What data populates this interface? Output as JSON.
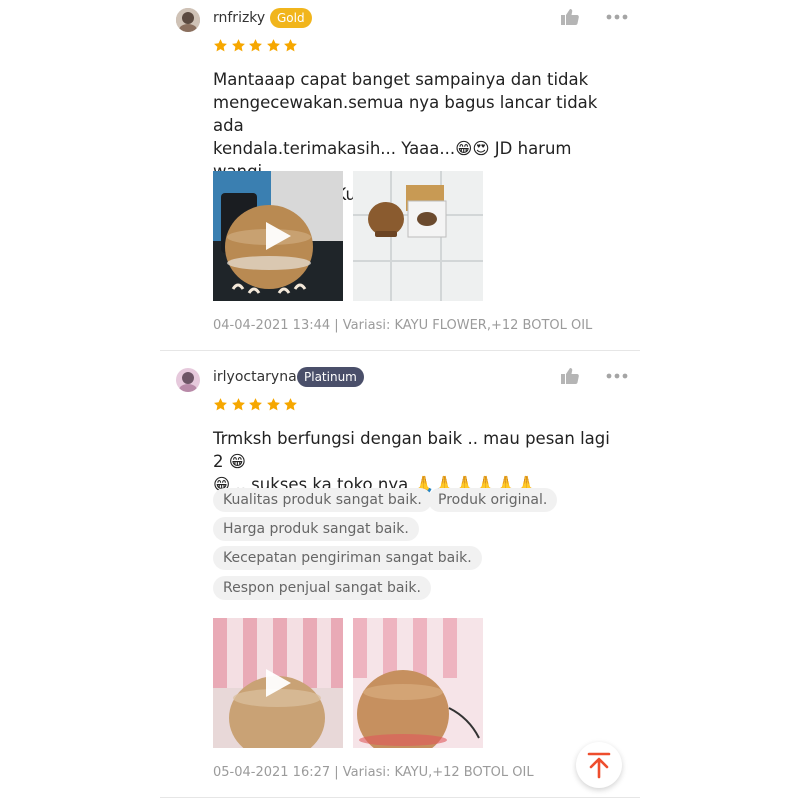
{
  "reviews": [
    {
      "username": "rnfrizky",
      "badge": "Gold",
      "rating": 5,
      "text_lines": [
        "Mantaaap capat banget sampainya dan tidak",
        "mengecewakan.semua nya bagus lancar tidak ada",
        "kendala.terimakasih... Yaaa...😁😍 JD harum wangi",
        "banget rumah Ku...😍😍😁"
      ],
      "meta": "04-04-2021 13:44 | Variasi: KAYU FLOWER,+12 BOTOL OIL",
      "media": [
        {
          "type": "video",
          "icon": "play-icon"
        },
        {
          "type": "photo"
        }
      ]
    },
    {
      "username": "irlyoctaryna",
      "badge": "Platinum",
      "rating": 5,
      "text_lines": [
        "Trmksh berfungsi dengan baik .. mau pesan lagi 2 😁",
        "😁 .. sukses ka toko nya 🙏🙏🙏🙏🙏🙏"
      ],
      "tags": [
        "Kualitas produk sangat baik.",
        "Produk original.",
        "Harga produk sangat baik.",
        "Kecepatan pengiriman sangat baik.",
        "Respon penjual sangat baik."
      ],
      "meta": "05-04-2021 16:27 | Variasi: KAYU,+12 BOTOL OIL",
      "media": [
        {
          "type": "video",
          "icon": "play-icon"
        },
        {
          "type": "photo"
        }
      ]
    }
  ],
  "colors": {
    "star": "#f6a700",
    "gold_badge": "#f1b51c",
    "platinum_badge": "#4a4f6a",
    "accent": "#ee4d2d"
  },
  "icons": [
    "thumbs-up-icon",
    "more-options-icon",
    "star-icon",
    "play-icon",
    "back-to-top-icon"
  ]
}
